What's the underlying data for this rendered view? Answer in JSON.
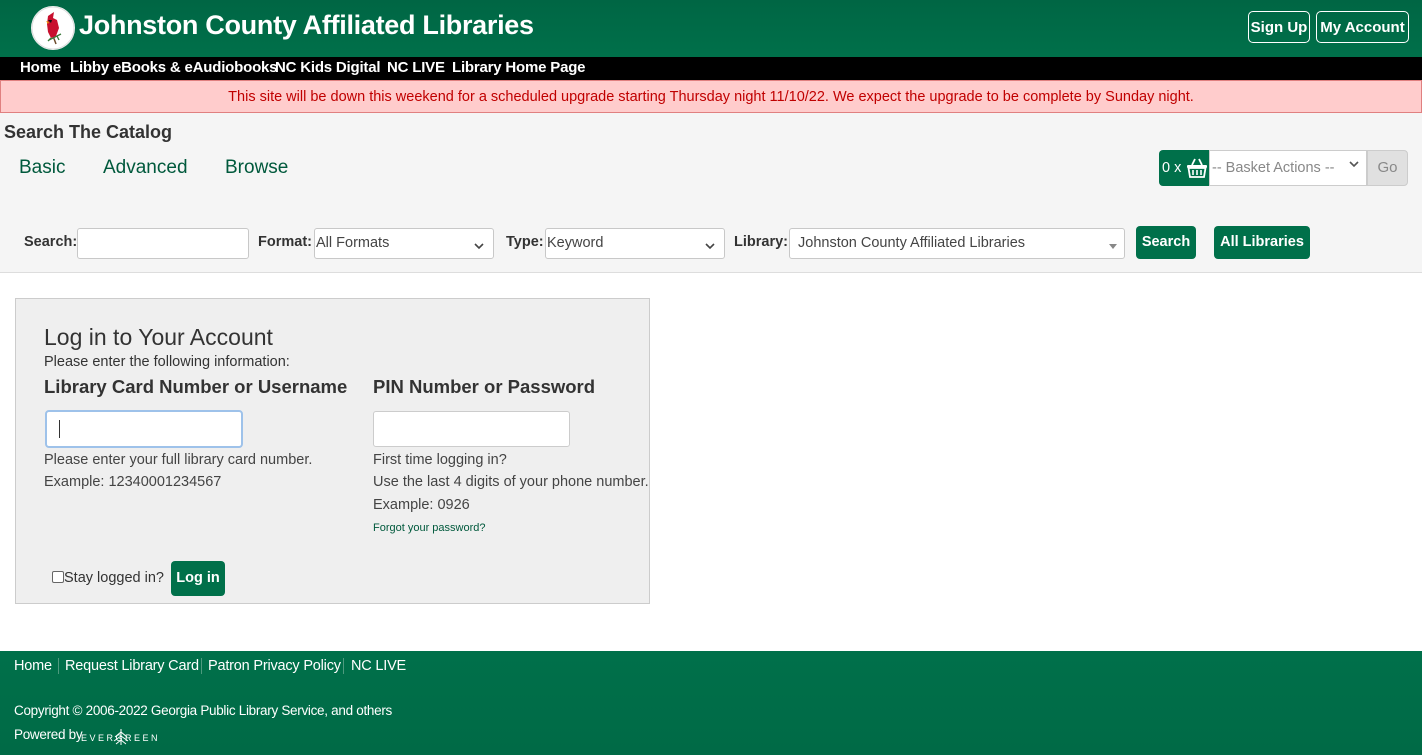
{
  "header": {
    "site_title": "Johnston County Affiliated Libraries",
    "signup_label": "Sign Up",
    "account_label": "My Account"
  },
  "nav": {
    "items": [
      "Home",
      "Libby eBooks & eAudiobooks",
      "NC Kids Digital",
      "NC LIVE",
      "Library Home Page"
    ]
  },
  "alert": {
    "text": "This site will be down this weekend for a scheduled upgrade starting Thursday night 11/10/22. We expect the upgrade to be complete by Sunday night."
  },
  "search": {
    "title": "Search The Catalog",
    "tabs": [
      "Basic",
      "Advanced",
      "Browse"
    ],
    "search_label": "Search:",
    "search_value": "",
    "format_label": "Format:",
    "format_value": "All Formats",
    "type_label": "Type:",
    "type_value": "Keyword",
    "library_label": "Library:",
    "library_value": "Johnston County Affiliated Libraries",
    "search_button": "Search",
    "all_libraries_button": "All Libraries"
  },
  "basket": {
    "count": "0 x",
    "actions_placeholder": "-- Basket Actions --",
    "go_label": "Go"
  },
  "login": {
    "title": "Log in to Your Account",
    "instructions": "Please enter the following information:",
    "card_label": "Library Card Number or Username",
    "card_value": "",
    "card_hint1": "Please enter your full library card number.",
    "card_hint2": "Example: 12340001234567",
    "pin_label": "PIN Number or Password",
    "pin_value": "",
    "pin_hint1": "First time logging in?",
    "pin_hint2": "Use the last 4 digits of your phone number.",
    "pin_hint3": "Example: 0926",
    "forgot_link": "Forgot your password?",
    "stay_logged_in": "Stay logged in?",
    "stay_checked": false,
    "login_button": "Log in"
  },
  "footer": {
    "links": [
      "Home",
      "Request Library Card",
      "Patron Privacy Policy",
      "NC LIVE"
    ],
    "copyright": "Copyright © 2006-2022 Georgia Public Library Service, and others",
    "powered_by": "Powered by",
    "evergreen_logo": "EVERGREEN"
  },
  "colors": {
    "brand_green": "#00704a",
    "nav_black": "#000000",
    "alert_bg": "#ffcccc",
    "alert_text": "#c00000"
  },
  "icons": {
    "logo": "cardinal-bird-logo",
    "basket": "basket-icon",
    "dropdown": "chevron-down-icon",
    "evergreen": "evergreen-tree-logo"
  }
}
